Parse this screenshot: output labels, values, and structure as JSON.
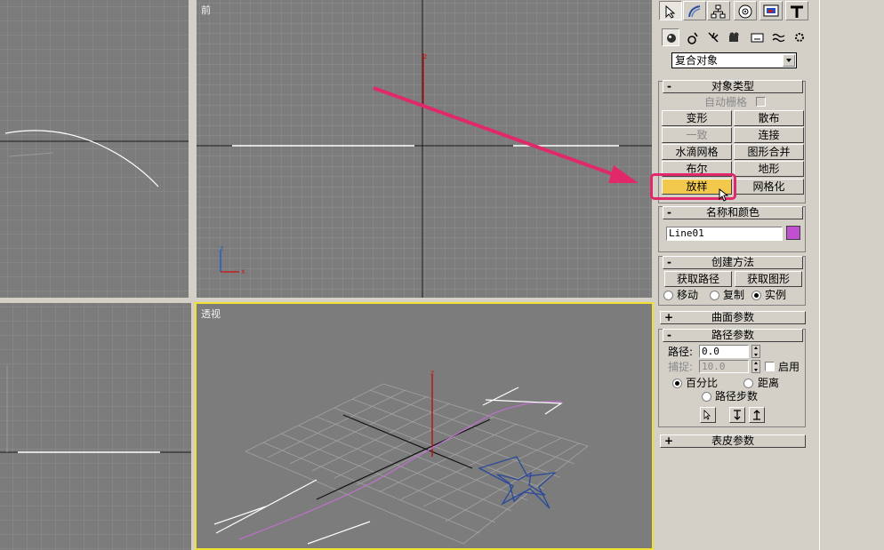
{
  "viewports": {
    "top_left": {
      "label": ""
    },
    "front": {
      "label": "前"
    },
    "left": {
      "label": ""
    },
    "perspective": {
      "label": "透视"
    }
  },
  "command_panel": {
    "tabs": [
      {
        "name": "create-tab-icon",
        "active": true
      },
      {
        "name": "modify-tab-icon",
        "active": false
      },
      {
        "name": "hierarchy-tab-icon",
        "active": false
      },
      {
        "name": "motion-tab-icon",
        "active": false
      },
      {
        "name": "display-tab-icon",
        "active": false
      },
      {
        "name": "utilities-tab-icon",
        "active": false
      }
    ],
    "subcategory_icons": [
      "geometry-icon",
      "shapes-icon",
      "lights-icon",
      "cameras-icon",
      "helpers-icon",
      "space-warps-icon",
      "systems-icon"
    ],
    "category_dropdown": {
      "value": "复合对象"
    },
    "object_type": {
      "title": "对象类型",
      "autogrid_label": "自动栅格",
      "buttons": [
        {
          "label": "变形",
          "enabled": true
        },
        {
          "label": "散布",
          "enabled": true
        },
        {
          "label": "一致",
          "enabled": false
        },
        {
          "label": "连接",
          "enabled": true
        },
        {
          "label": "水滴网格",
          "enabled": true
        },
        {
          "label": "图形合并",
          "enabled": true
        },
        {
          "label": "布尔",
          "enabled": true
        },
        {
          "label": "地形",
          "enabled": true
        },
        {
          "label": "放样",
          "enabled": true,
          "active": true
        },
        {
          "label": "网格化",
          "enabled": true
        }
      ]
    },
    "name_color": {
      "title": "名称和颜色",
      "name_value": "Line01",
      "color": "#c050d0"
    },
    "creation_method": {
      "title": "创建方法",
      "get_path_label": "获取路径",
      "get_shape_label": "获取图形",
      "options": [
        "移动",
        "复制",
        "实例"
      ],
      "selected": "实例"
    },
    "surface_params": {
      "title": "曲面参数",
      "sign": "+"
    },
    "path_params": {
      "title": "路径参数",
      "path_label": "路径:",
      "path_value": "0.0",
      "snap_label": "捕捉:",
      "snap_value": "10.0",
      "enable_label": "启用",
      "percent_label": "百分比",
      "distance_label": "距离",
      "path_steps_label": "路径步数",
      "selected": "百分比"
    },
    "skin_params": {
      "title": "表皮参数",
      "sign": "+"
    }
  },
  "colors": {
    "viewport_bg": "#7c7c7c",
    "active_viewport_border": "#f0e030",
    "annotation": "#e0286a",
    "highlight_button": "#f2c94c",
    "loft_path": "#c070d0",
    "star_shape": "#2a4a9a"
  }
}
